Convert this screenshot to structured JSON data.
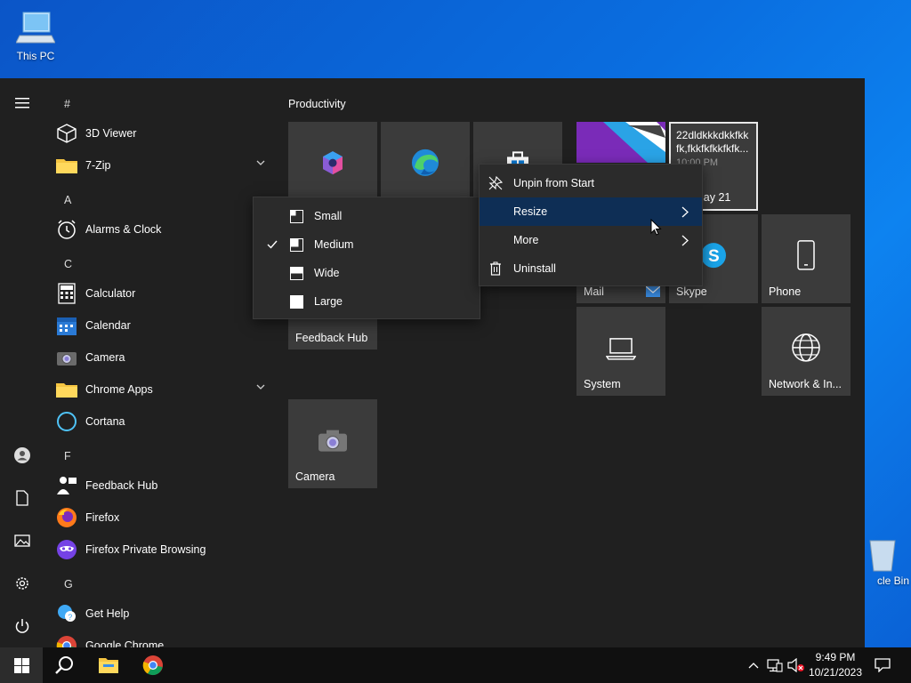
{
  "desktop": {
    "this_pc_label": "This PC",
    "recycle_bin_label": "cle Bin"
  },
  "app_list": {
    "sections": [
      {
        "letter": "#"
      },
      {
        "letter": "A"
      },
      {
        "letter": "C"
      },
      {
        "letter": "F"
      },
      {
        "letter": "G"
      }
    ],
    "items": [
      {
        "label": "3D Viewer",
        "icon": "cube-icon"
      },
      {
        "label": "7-Zip",
        "icon": "folder-icon",
        "expandable": true
      },
      {
        "label": "Alarms & Clock",
        "icon": "clock-icon"
      },
      {
        "label": "Calculator",
        "icon": "calculator-icon"
      },
      {
        "label": "Calendar",
        "icon": "calendar-icon"
      },
      {
        "label": "Camera",
        "icon": "camera-icon"
      },
      {
        "label": "Chrome Apps",
        "icon": "folder-icon",
        "expandable": true
      },
      {
        "label": "Cortana",
        "icon": "cortana-icon"
      },
      {
        "label": "Feedback Hub",
        "icon": "feedback-hub-icon"
      },
      {
        "label": "Firefox",
        "icon": "firefox-icon"
      },
      {
        "label": "Firefox Private Browsing",
        "icon": "firefox-private-icon"
      },
      {
        "label": "Get Help",
        "icon": "get-help-icon"
      },
      {
        "label": "Google Chrome",
        "icon": "chrome-icon"
      }
    ]
  },
  "tiles": {
    "group_title": "Productivity",
    "items": [
      {
        "name": "office",
        "label": ""
      },
      {
        "name": "edge",
        "label": ""
      },
      {
        "name": "store",
        "label": ""
      },
      {
        "name": "photo",
        "label": ""
      },
      {
        "name": "calendar-live",
        "label": "lay 21",
        "text_line1": "22dldkkkdkkfkk",
        "text_line2": "fk,fkkfkfkkfkfk...",
        "time": "10:00 PM"
      },
      {
        "name": "mail",
        "label": "Mail"
      },
      {
        "name": "skype",
        "label": "Skype"
      },
      {
        "name": "phone",
        "label": "Phone"
      },
      {
        "name": "feedback-hub",
        "label": "Feedback Hub"
      },
      {
        "name": "system",
        "label": "System"
      },
      {
        "name": "network",
        "label": "Network & In..."
      },
      {
        "name": "camera",
        "label": "Camera"
      }
    ]
  },
  "context_menu": {
    "items": [
      {
        "label": "Unpin from Start",
        "icon": "unpin-icon"
      },
      {
        "label": "Resize",
        "submenu": true,
        "highlighted": true
      },
      {
        "label": "More",
        "submenu": true
      },
      {
        "label": "Uninstall",
        "icon": "trash-icon"
      }
    ]
  },
  "resize_menu": {
    "items": [
      {
        "label": "Small",
        "checked": false
      },
      {
        "label": "Medium",
        "checked": true
      },
      {
        "label": "Wide",
        "checked": false
      },
      {
        "label": "Large",
        "checked": false
      }
    ]
  },
  "taskbar": {
    "time": "9:49 PM",
    "date": "10/21/2023"
  },
  "colors": {
    "accent_highlight": "#0e2e55",
    "tile_bg": "#3b3b3b",
    "menu_bg": "#2b2b2b",
    "start_bg": "#202020"
  }
}
